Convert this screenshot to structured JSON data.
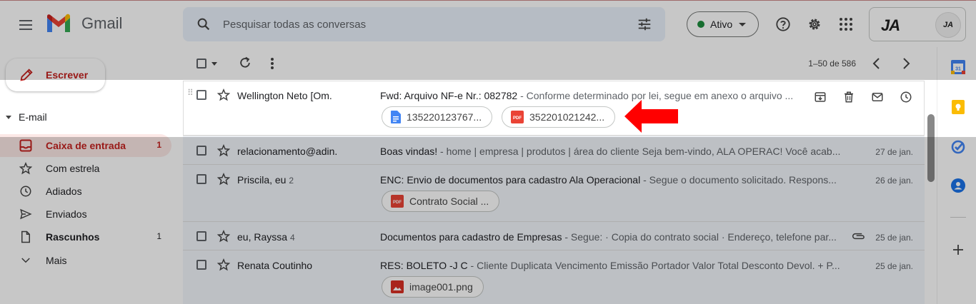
{
  "header": {
    "app_name": "Gmail",
    "search_placeholder": "Pesquisar todas as conversas",
    "status_label": "Ativo",
    "account_logo_text": "JA",
    "avatar_text": "JA"
  },
  "nav": {
    "compose_label": "Escrever",
    "section_label": "E-mail",
    "items": [
      {
        "label": "Caixa de entrada",
        "count": "1",
        "icon": "inbox-icon"
      },
      {
        "label": "Com estrela",
        "count": "",
        "icon": "star-icon"
      },
      {
        "label": "Adiados",
        "count": "",
        "icon": "clock-icon"
      },
      {
        "label": "Enviados",
        "count": "",
        "icon": "send-icon"
      },
      {
        "label": "Rascunhos",
        "count": "1",
        "icon": "draft-icon"
      },
      {
        "label": "Mais",
        "count": "",
        "icon": "chevron-down-icon"
      }
    ]
  },
  "toolbar": {
    "pagination": "1–50 de 586"
  },
  "emails": [
    {
      "sender": "Wellington Neto [Om.",
      "sender_count": "",
      "subject": "Fwd: Arquivo NF-e Nr.: 082782",
      "snippet": " - Conforme determinado por lei, segue em anexo o arquivo ...",
      "date": "",
      "attachments": [
        "135220123767...",
        "352201021242..."
      ]
    },
    {
      "sender": "relacionamento@adin.",
      "sender_count": "",
      "subject": "Boas vindas!",
      "snippet": " - home | empresa | produtos | área do cliente Seja bem-vindo, ALA OPERAC! Você acab...",
      "date": "27 de jan."
    },
    {
      "sender": "Priscila, eu",
      "sender_count": "2",
      "subject": "ENC: Envio de documentos para cadastro Ala Operacional",
      "snippet": " - Segue o documento solicitado. Respons...",
      "date": "26 de jan.",
      "attachments": [
        "Contrato Social ..."
      ]
    },
    {
      "sender": "eu, Rayssa",
      "sender_count": "4",
      "subject": "Documentos para cadastro de Empresas",
      "snippet": " - Segue: · Copia do contrato social · Endereço, telefone par...",
      "date": "25 de jan."
    },
    {
      "sender": "Renata Coutinho",
      "sender_count": "",
      "subject": "RES: BOLETO -J C",
      "snippet": " - Cliente Duplicata Vencimento Emissão Portador Valor Total Desconto Devol. + P...",
      "date": "25 de jan.",
      "attachments": [
        "image001.png"
      ]
    }
  ],
  "colors": {
    "accent_red": "#c5221f",
    "arrow_red": "#ff0000",
    "status_green": "#1e8e3e"
  }
}
